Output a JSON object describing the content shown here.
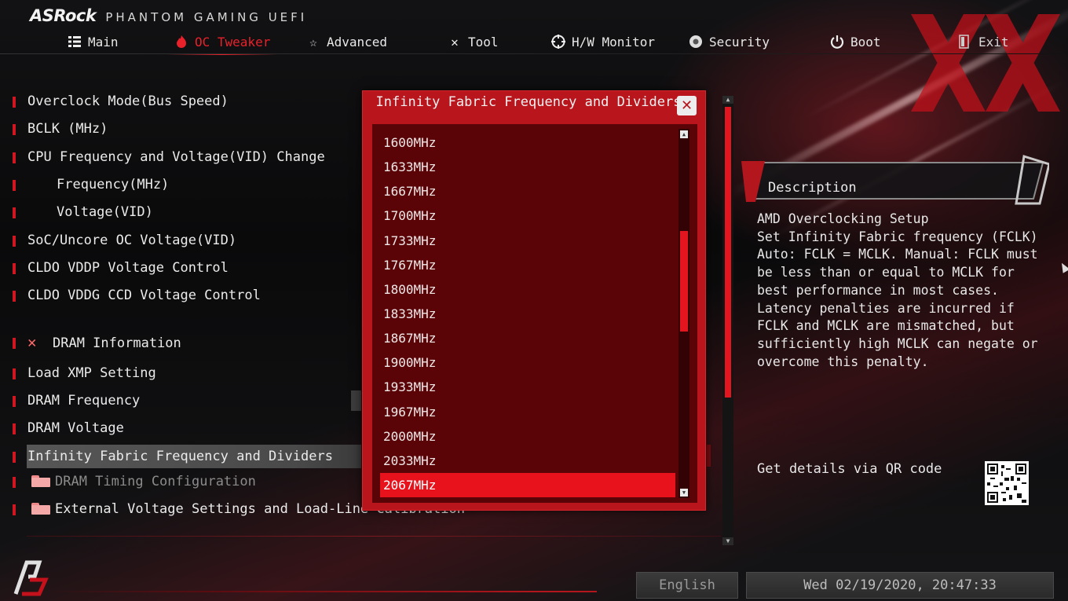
{
  "brand": {
    "logo": "ASRock",
    "subtitle": "PHANTOM GAMING UEFI"
  },
  "nav": {
    "tabs": [
      {
        "label": "Main",
        "icon": "list-icon"
      },
      {
        "label": "OC Tweaker",
        "icon": "flame-icon",
        "active": true
      },
      {
        "label": "Advanced",
        "icon": "star-icon"
      },
      {
        "label": "Tool",
        "icon": "tools-icon"
      },
      {
        "label": "H/W Monitor",
        "icon": "crosshair-icon"
      },
      {
        "label": "Security",
        "icon": "shield-icon"
      },
      {
        "label": "Boot",
        "icon": "power-icon"
      },
      {
        "label": "Exit",
        "icon": "exit-icon"
      }
    ]
  },
  "menu": {
    "items": [
      {
        "label": "Overclock Mode(Bus Speed)"
      },
      {
        "label": "BCLK (MHz)"
      },
      {
        "label": "CPU Frequency and Voltage(VID) Change"
      },
      {
        "label": "Frequency(MHz)"
      },
      {
        "label": "Voltage(VID)"
      },
      {
        "label": "SoC/Uncore OC Voltage(VID)"
      },
      {
        "label": "CLDO VDDP Voltage Control"
      },
      {
        "label": "CLDO VDDG CCD Voltage Control"
      },
      {
        "label": "DRAM Information"
      },
      {
        "label": "Load XMP Setting"
      },
      {
        "label": "DRAM Frequency"
      },
      {
        "label": "DRAM Voltage"
      },
      {
        "label": "Infinity Fabric Frequency and Dividers"
      },
      {
        "label": "DRAM Timing Configuration"
      },
      {
        "label": "External Voltage Settings and Load-Line Calibration"
      }
    ]
  },
  "popup": {
    "title": "Infinity Fabric Frequency and Dividers",
    "close_icon": "close-icon",
    "options": [
      "1600MHz",
      "1633MHz",
      "1667MHz",
      "1700MHz",
      "1733MHz",
      "1767MHz",
      "1800MHz",
      "1833MHz",
      "1867MHz",
      "1900MHz",
      "1933MHz",
      "1967MHz",
      "2000MHz",
      "2033MHz",
      "2067MHz"
    ],
    "selected": "2067MHz"
  },
  "description": {
    "title": "Description",
    "text": "AMD Overclocking Setup\nSet Infinity Fabric frequency (FCLK)\nAuto: FCLK = MCLK. Manual: FCLK must\nbe less than or equal to MCLK for\nbest performance in most cases.\nLatency penalties are incurred if\nFCLK and MCLK are mismatched, but\nsufficiently high MCLK can negate or\novercome this penalty.",
    "qr_label": "Get details via QR code"
  },
  "footer": {
    "language": "English",
    "datetime": "Wed 02/19/2020, 20:47:33"
  },
  "colors": {
    "accent": "#e8121c",
    "popup": "#b8151d",
    "popup_list": "#5a0407"
  }
}
